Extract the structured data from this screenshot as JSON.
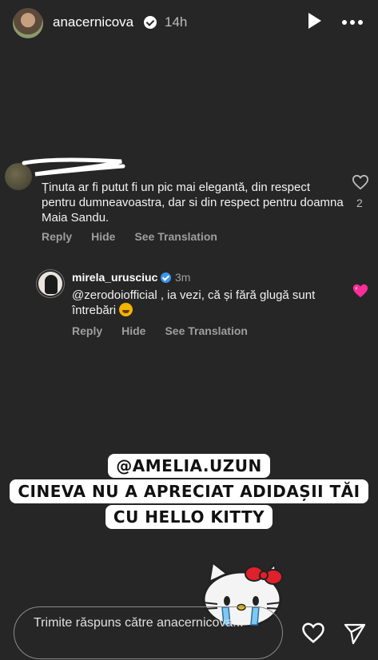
{
  "header": {
    "username": "anacernicova",
    "time": "14h",
    "icons": [
      "avatar",
      "verified-badge-icon",
      "play-icon",
      "more-icon"
    ]
  },
  "comment": {
    "text": "Ținuta ar fi putut fi un pic mai elegantă, din respect pentru dumneavoastra, dar si din respect pentru doamna Maia Sandu.",
    "like_count": "2",
    "actions": {
      "reply": "Reply",
      "hide": "Hide",
      "translate": "See Translation"
    }
  },
  "reply": {
    "username": "mirela_urusciuc",
    "time": "3m",
    "text": "@zerodoiofficial , ia vezi, că și fără glugă sunt întrebări",
    "actions": {
      "reply": "Reply",
      "hide": "Hide",
      "translate": "See Translation"
    }
  },
  "banner": {
    "line1": "@AMELIA.UZUN",
    "line2": "CINEVA NU A APRECIAT ADIDAȘII TĂI",
    "line3": "CU HELLO KITTY"
  },
  "reply_bar": {
    "placeholder": "Trimite răspuns către anacernicova..."
  },
  "colors": {
    "background": "#262626",
    "verified_blue": "#3897f0",
    "pink_heart": "#ff2d9a"
  }
}
